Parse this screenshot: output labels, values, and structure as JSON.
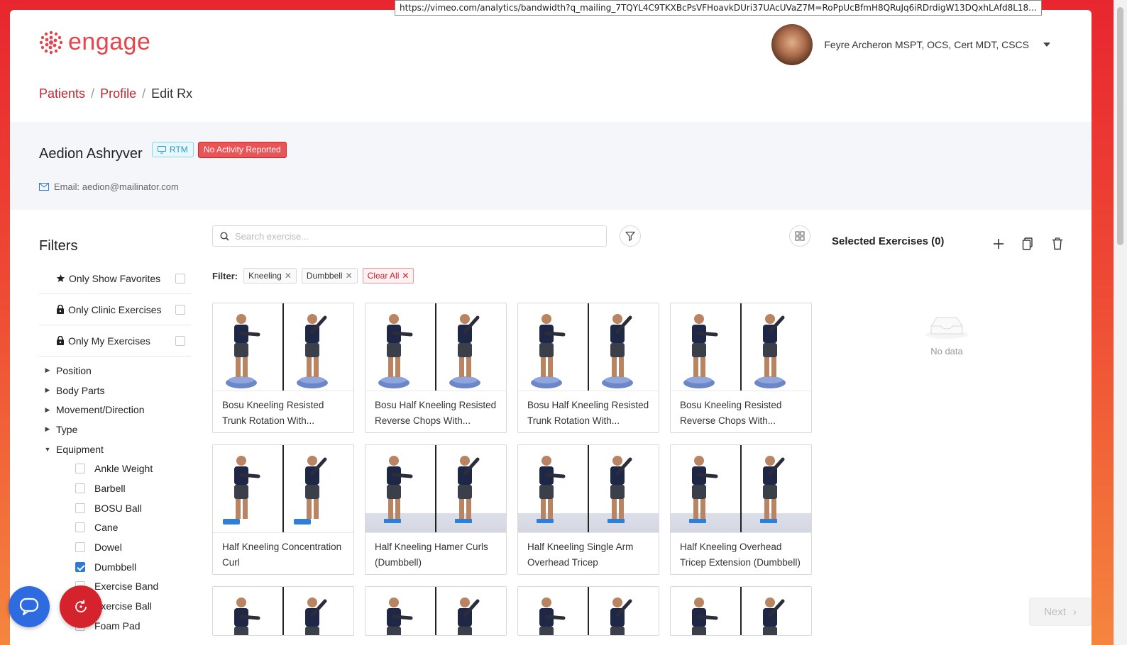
{
  "browser": {
    "status_url": "https://vimeo.com/analytics/bandwidth?q_mailing_7TQYL4C9TKXBcPsVFHoavkDUri37UAcUVaZ7M=RoPpUcBfmH8QRuJq6iRDrdigW13DQxhLAfd8L18..."
  },
  "header": {
    "logo_text": "engage",
    "user_name": "Feyre Archeron MSPT, OCS, Cert MDT, CSCS"
  },
  "breadcrumb": {
    "items": [
      "Patients",
      "Profile",
      "Edit Rx"
    ],
    "separator": "/"
  },
  "patient": {
    "name": "Aedion Ashryver",
    "tag_rtm": "RTM",
    "tag_status": "No Activity Reported",
    "email": "Email: aedion@mailinator.com"
  },
  "filters": {
    "title": "Filters",
    "toggles": [
      {
        "label": "Only Show Favorites",
        "icon": "star-icon",
        "checked": false
      },
      {
        "label": "Only Clinic Exercises",
        "icon": "lock-icon",
        "checked": false
      },
      {
        "label": "Only My Exercises",
        "icon": "lock-icon",
        "checked": false
      }
    ],
    "tree": [
      {
        "label": "Position",
        "expanded": false
      },
      {
        "label": "Body Parts",
        "expanded": false
      },
      {
        "label": "Movement/Direction",
        "expanded": false
      },
      {
        "label": "Type",
        "expanded": false
      },
      {
        "label": "Equipment",
        "expanded": true
      }
    ],
    "equipment": [
      {
        "label": "Ankle Weight",
        "checked": false
      },
      {
        "label": "Barbell",
        "checked": false
      },
      {
        "label": "BOSU Ball",
        "checked": false
      },
      {
        "label": "Cane",
        "checked": false
      },
      {
        "label": "Dowel",
        "checked": false
      },
      {
        "label": "Dumbbell",
        "checked": true
      },
      {
        "label": "Exercise Band",
        "checked": false
      },
      {
        "label": "Exercise Ball",
        "checked": false
      },
      {
        "label": "Foam Pad",
        "checked": false
      }
    ]
  },
  "search": {
    "placeholder": "Search exercise..."
  },
  "active_filters": {
    "label": "Filter:",
    "chips": [
      "Kneeling",
      "Dumbbell"
    ],
    "clear_label": "Clear All"
  },
  "exercises": [
    {
      "title": "Bosu Kneeling Resisted Trunk Rotation With...",
      "kind": "bosu"
    },
    {
      "title": "Bosu Half Kneeling Resisted Reverse Chops With...",
      "kind": "bosu"
    },
    {
      "title": "Bosu Half Kneeling Resisted Trunk Rotation With...",
      "kind": "bosu"
    },
    {
      "title": "Bosu Kneeling Resisted Reverse Chops With...",
      "kind": "bosu"
    },
    {
      "title": "Half Kneeling Concentration Curl",
      "kind": "pad"
    },
    {
      "title": "Half Kneeling Hamer Curls (Dumbbell)",
      "kind": "mat"
    },
    {
      "title": "Half Kneeling Single Arm Overhead Tricep Extension...",
      "kind": "mat"
    },
    {
      "title": "Half Kneeling Overhead Tricep Extension (Dumbbell)",
      "kind": "mat"
    },
    {
      "title": "",
      "kind": "partial"
    },
    {
      "title": "",
      "kind": "partial"
    },
    {
      "title": "",
      "kind": "partial"
    },
    {
      "title": "",
      "kind": "partial"
    }
  ],
  "selected": {
    "title": "Selected Exercises (0)",
    "empty_text": "No data"
  },
  "footer": {
    "next_label": "Next"
  },
  "colors": {
    "brand_red": "#e8434b",
    "link_red": "#c0262e",
    "primary_blue": "#2f79d8"
  }
}
